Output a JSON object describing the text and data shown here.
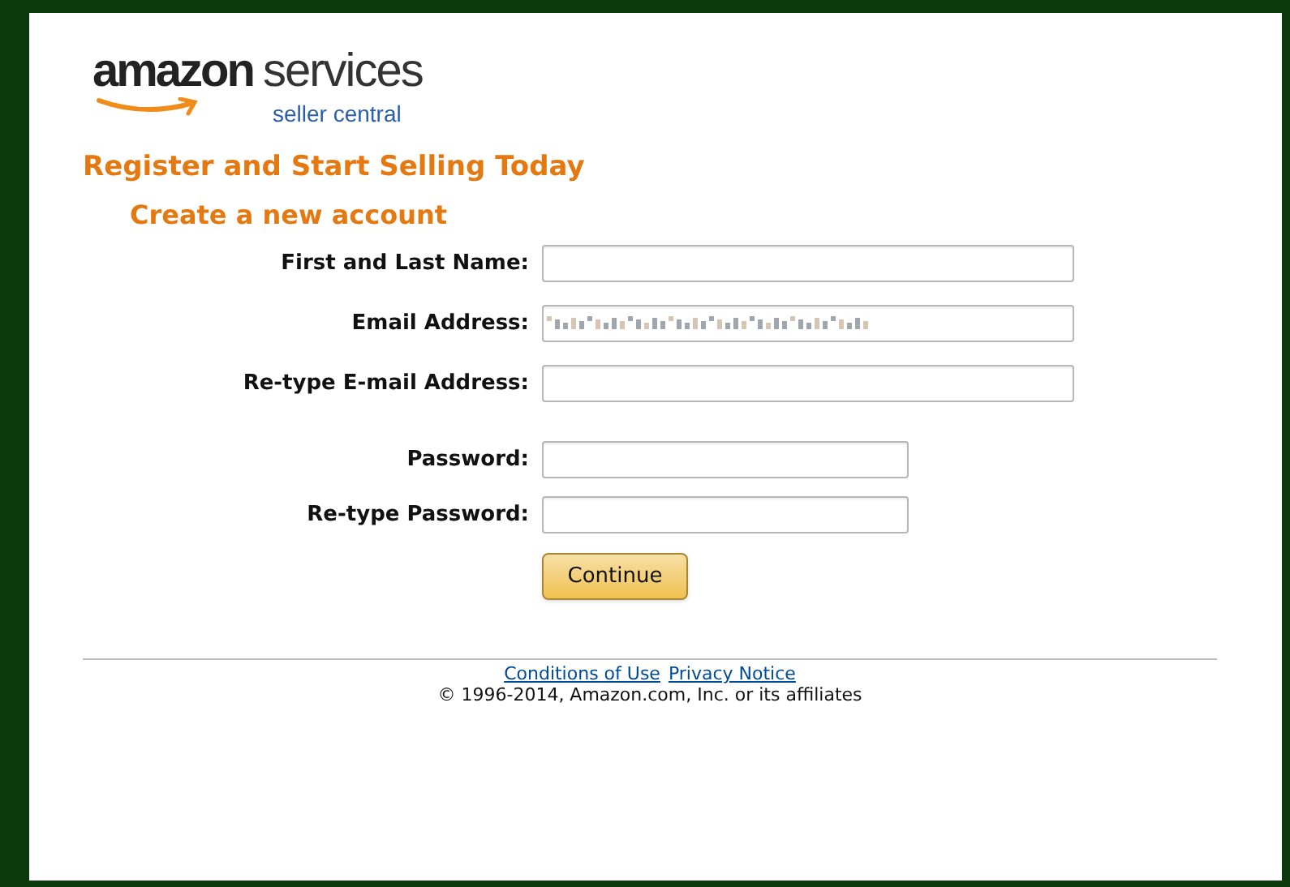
{
  "logo": {
    "brand": "amazon",
    "product": "services",
    "tagline": "seller central"
  },
  "heading": "Register and Start Selling Today",
  "subheading": "Create a new account",
  "fields": [
    {
      "label": "First and Last Name:",
      "kind": "text",
      "redacted": false
    },
    {
      "label": "Email Address:",
      "kind": "text",
      "redacted": true
    },
    {
      "label": "Re-type E-mail Address:",
      "kind": "text",
      "redacted": false
    },
    {
      "label": "Password:",
      "kind": "password",
      "redacted": false
    },
    {
      "label": "Re-type Password:",
      "kind": "password",
      "redacted": false
    }
  ],
  "submit": "Continue",
  "footer": {
    "links": [
      "Conditions of Use",
      "Privacy Notice"
    ],
    "copyright": "© 1996-2014, Amazon.com, Inc. or its affiliates"
  }
}
